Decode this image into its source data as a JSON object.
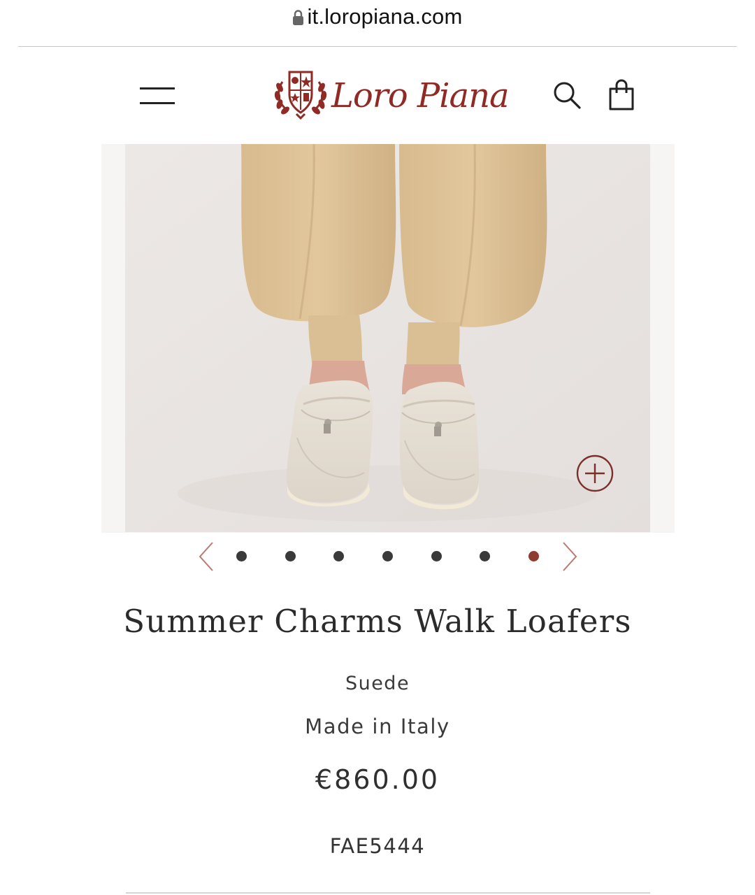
{
  "browser": {
    "url": "it.loropiana.com",
    "lock_icon": "lock-icon"
  },
  "header": {
    "menu_icon": "hamburger-menu-icon",
    "brand_name": "Loro Piana",
    "search_icon": "search-icon",
    "bag_icon": "shopping-bag-icon"
  },
  "gallery": {
    "image_description": "product photo",
    "zoom_icon": "plus-circle-icon",
    "prev_icon": "chevron-left-icon",
    "next_icon": "chevron-right-icon",
    "slide_count": 7,
    "active_slide": 7
  },
  "product": {
    "name": "Summer Charms Walk Loafers",
    "material": "Suede",
    "origin": "Made in Italy",
    "price": "€860.00",
    "sku": "FAE5444"
  },
  "colors": {
    "brand": "#8f2a25",
    "active_dot": "#8f3b30",
    "inactive_dot": "#3a3a3a",
    "text": "#2b2b2b"
  }
}
